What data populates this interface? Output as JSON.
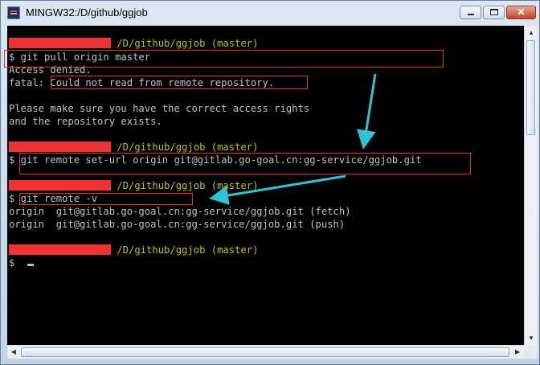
{
  "window": {
    "title": "MINGW32:/D/github/ggjob",
    "icon": "terminal-icon",
    "controls": {
      "minimize": "minimize-icon",
      "maximize": "maximize-icon",
      "close": "✕"
    }
  },
  "terminal": {
    "prompt_path": "/D/github/ggjob (master)",
    "lines": [
      {
        "kind": "prompt",
        "path": "/D/github/ggjob (master)"
      },
      {
        "kind": "text",
        "text": "$ git pull origin master"
      },
      {
        "kind": "text",
        "text": "Access denied."
      },
      {
        "kind": "text",
        "text": "fatal: Could not read from remote repository."
      },
      {
        "kind": "text",
        "text": ""
      },
      {
        "kind": "text",
        "text": "Please make sure you have the correct access rights"
      },
      {
        "kind": "text",
        "text": "and the repository exists."
      },
      {
        "kind": "text",
        "text": ""
      },
      {
        "kind": "prompt",
        "path": "/D/github/ggjob (master)"
      },
      {
        "kind": "text",
        "text": "$ git remote set-url origin git@gitlab.go-goal.cn:gg-service/ggjob.git"
      },
      {
        "kind": "text",
        "text": ""
      },
      {
        "kind": "prompt",
        "path": "/D/github/ggjob (master)"
      },
      {
        "kind": "text",
        "text": "$ git remote -v"
      },
      {
        "kind": "text",
        "text": "origin  git@gitlab.go-goal.cn:gg-service/ggjob.git (fetch)"
      },
      {
        "kind": "text",
        "text": "origin  git@gitlab.go-goal.cn:gg-service/ggjob.git (push)"
      },
      {
        "kind": "text",
        "text": ""
      },
      {
        "kind": "prompt",
        "path": "/D/github/ggjob (master)"
      },
      {
        "kind": "text",
        "text": "$ "
      }
    ]
  },
  "annotations": {
    "box_color": "#e03030",
    "arrow_color": "#2ec4d6"
  },
  "colors": {
    "background": "#000000",
    "text": "#c0c0c0",
    "prompt_path": "#c0c000",
    "redaction": "#ee3333"
  }
}
